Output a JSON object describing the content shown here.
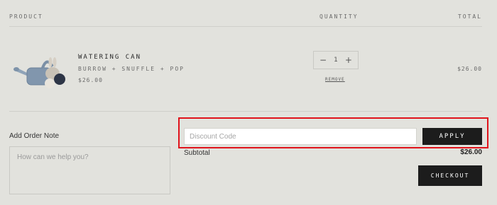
{
  "table_header": {
    "product": "PRODUCT",
    "quantity": "QUANTITY",
    "total": "TOTAL"
  },
  "item": {
    "name": "WATERING CAN",
    "vendor": "BURROW + SNUFFLE + POP",
    "price": "$26.00",
    "quantity": "1",
    "remove_label": "REMOVE",
    "line_total": "$26.00",
    "image_icon": "knitted-watering-can-toy"
  },
  "order_note": {
    "label": "Add Order Note",
    "placeholder": "How can we help you?"
  },
  "discount": {
    "placeholder": "Discount Code",
    "apply_label": "APPLY",
    "highlight_color": "#e0131b"
  },
  "summary": {
    "subtotal_label": "Subtotal",
    "subtotal_value": "$26.00",
    "checkout_label": "CHECKOUT"
  },
  "colors": {
    "background": "#e2e2dd",
    "button": "#1c1c1c"
  }
}
